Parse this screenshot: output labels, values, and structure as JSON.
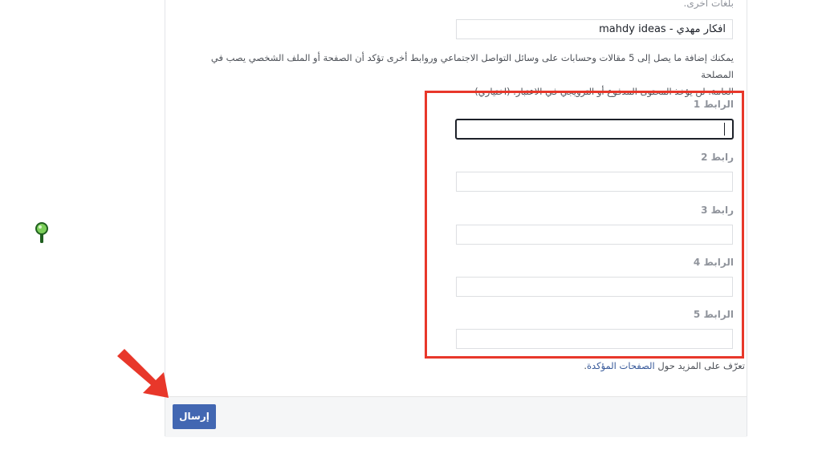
{
  "form": {
    "top_label": "بلغات أخرى.",
    "page_name_value": "افكار مهدي - mahdy ideas",
    "description_line1": "يمكنك إضافة ما يصل إلى 5 مقالات وحسابات على وسائل التواصل الاجتماعي وروابط أخرى تؤكد أن الصفحة أو الملف الشخصي يصب في المصلحة",
    "description_line2": "العامة. لن يؤخذ المحتوى المدفوع أو الترويجي في الاعتبار. (اختياري)",
    "links": [
      {
        "label": "الرابط 1",
        "value": ""
      },
      {
        "label": "رابط 2",
        "value": ""
      },
      {
        "label": "رابط 3",
        "value": ""
      },
      {
        "label": "الرابط 4",
        "value": ""
      },
      {
        "label": "الرابط 5",
        "value": ""
      }
    ],
    "learn_more_prefix": "تعرّف على المزيد حول ",
    "learn_more_link": "الصفحات المؤكدة",
    "learn_more_suffix": "."
  },
  "footer": {
    "submit_label": "إرسال"
  },
  "colors": {
    "highlight_box": "#e8372a",
    "submit_button": "#4267b2",
    "arrow": "#e8372a",
    "link": "#365899"
  },
  "icons": {
    "arrow": "red-arrow-icon",
    "watermark": "magnifier-logo-icon"
  }
}
